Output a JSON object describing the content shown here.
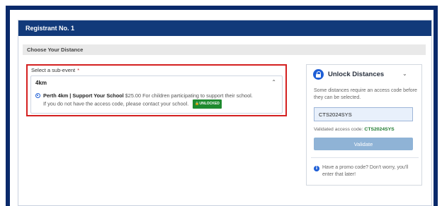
{
  "card": {
    "header": "Registrant No. 1",
    "section_title": "Choose Your Distance"
  },
  "sub_event": {
    "label": "Select a sub-event",
    "required_mark": "*",
    "box_title": "4km",
    "option": {
      "name": "Perth 4km | Support Your School",
      "price": "$25.00",
      "description_1": "For children participating to support their school.",
      "description_2": "If you do not have the access code, please contact your school.",
      "badge": "UNLOCKED",
      "selected": true
    }
  },
  "unlock": {
    "title": "Unlock Distances",
    "description": "Some distances require an access code before they can be selected.",
    "input_value": "CTS2024SYS",
    "validated_label": "Validated access code:",
    "validated_code": "CTS2024SYS",
    "validate_button": "Validate",
    "promo_text": "Have a promo code? Don't worry, you'll enter that later!"
  },
  "colors": {
    "header_blue": "#123a7a",
    "frame_blue": "#0a2a6b",
    "highlight_red": "#d42020",
    "badge_green": "#1e8a2f",
    "accent_blue": "#1f5fd6",
    "validate_btn": "#8fb3d6"
  },
  "icons": {
    "lock": "lock-icon",
    "chevron_up": "chevron-up-icon",
    "chevron_down": "chevron-down-icon",
    "info": "info-icon",
    "badge_lock": "lock-badge-icon"
  }
}
